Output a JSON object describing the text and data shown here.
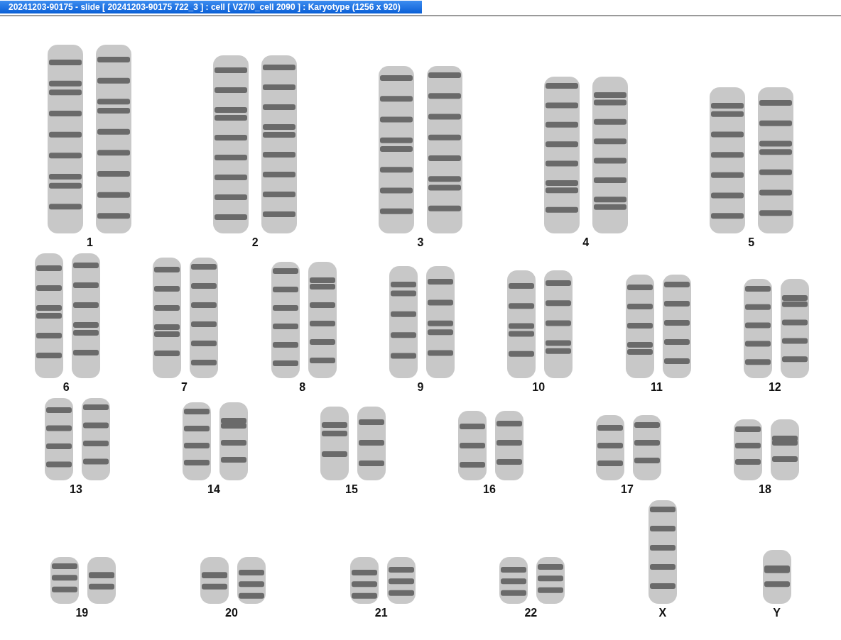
{
  "window": {
    "title": "20241203-90175 - slide [ 20241203-90175 722_3 ] : cell [ V27/0_cell 2090 ] : Karyotype  (1256 x 920)"
  },
  "karyotype": {
    "rows": [
      {
        "groups": [
          {
            "label": "1",
            "kind": "pair"
          },
          {
            "label": "2",
            "kind": "pair"
          },
          {
            "label": "3",
            "kind": "pair"
          },
          {
            "label": "4",
            "kind": "pair"
          },
          {
            "label": "5",
            "kind": "pair"
          }
        ]
      },
      {
        "groups": [
          {
            "label": "6",
            "kind": "pair"
          },
          {
            "label": "7",
            "kind": "pair"
          },
          {
            "label": "8",
            "kind": "pair"
          },
          {
            "label": "9",
            "kind": "pair"
          },
          {
            "label": "10",
            "kind": "pair"
          },
          {
            "label": "11",
            "kind": "pair"
          },
          {
            "label": "12",
            "kind": "pair"
          }
        ]
      },
      {
        "groups": [
          {
            "label": "13",
            "kind": "pair"
          },
          {
            "label": "14",
            "kind": "pair"
          },
          {
            "label": "15",
            "kind": "pair"
          },
          {
            "label": "16",
            "kind": "pair"
          },
          {
            "label": "17",
            "kind": "pair"
          },
          {
            "label": "18",
            "kind": "pair"
          }
        ]
      },
      {
        "groups": [
          {
            "label": "19",
            "kind": "pair"
          },
          {
            "label": "20",
            "kind": "pair"
          },
          {
            "label": "21",
            "kind": "pair"
          },
          {
            "label": "22",
            "kind": "pair"
          },
          {
            "label": "X",
            "kind": "single"
          },
          {
            "label": "Y",
            "kind": "single"
          }
        ]
      }
    ]
  }
}
